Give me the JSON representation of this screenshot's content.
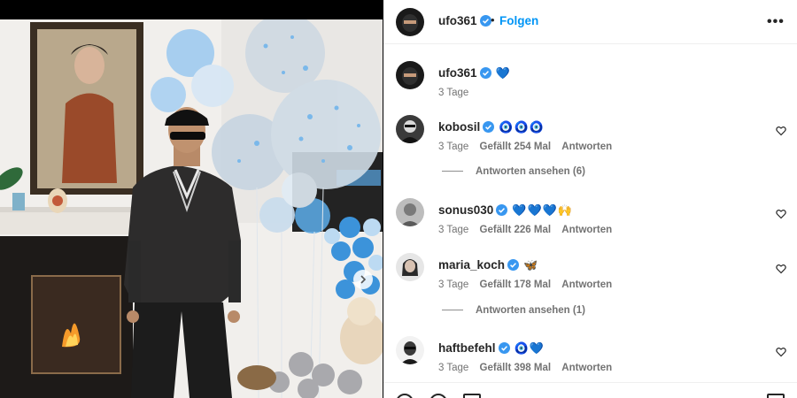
{
  "header": {
    "username": "ufo361",
    "separator": "•",
    "follow_label": "Folgen",
    "more_label": "•••"
  },
  "caption": {
    "username": "ufo361",
    "emojis": "💙",
    "time": "3 Tage"
  },
  "comments": [
    {
      "username": "kobosil",
      "emojis": "🧿🧿🧿",
      "time": "3 Tage",
      "likes": "Gefällt 254 Mal",
      "reply": "Antworten",
      "view_replies": "Antworten ansehen (6)"
    },
    {
      "username": "sonus030",
      "emojis": "💙💙💙🙌",
      "time": "3 Tage",
      "likes": "Gefällt 226 Mal",
      "reply": "Antworten"
    },
    {
      "username": "maria_koch",
      "emojis": "🦋",
      "time": "3 Tage",
      "likes": "Gefällt 178 Mal",
      "reply": "Antworten",
      "view_replies": "Antworten ansehen (1)"
    },
    {
      "username": "haftbefehl",
      "emojis": "🧿💙",
      "time": "3 Tage",
      "likes": "Gefällt 398 Mal",
      "reply": "Antworten"
    }
  ],
  "icons": {
    "verified": "verified-badge-icon",
    "heart": "heart-outline-icon",
    "next": "chevron-right-icon"
  },
  "colors": {
    "accent": "#0095f6",
    "verified": "#3897f0",
    "muted": "#737373",
    "text": "#262626"
  }
}
